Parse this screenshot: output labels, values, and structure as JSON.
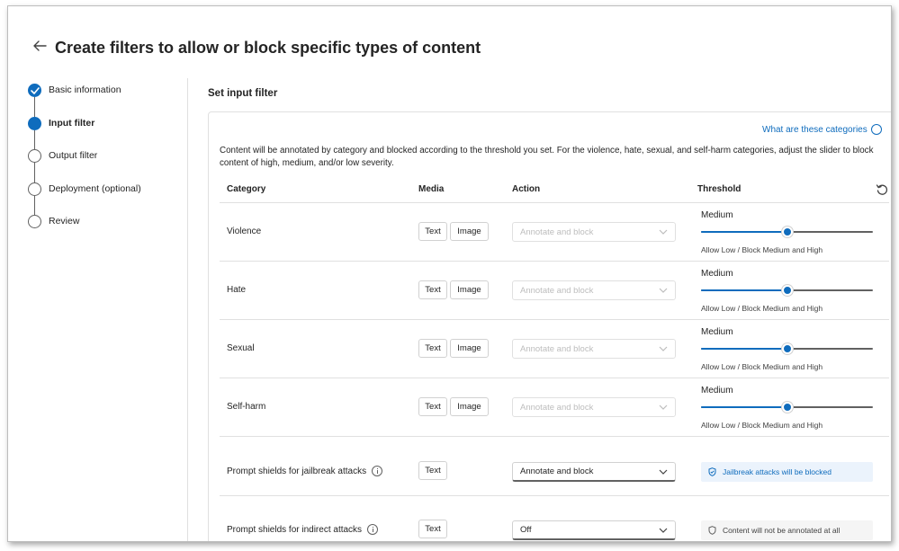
{
  "page": {
    "title": "Create filters to allow or block specific types of content"
  },
  "steps": [
    {
      "label": "Basic information",
      "state": "done"
    },
    {
      "label": "Input filter",
      "state": "current"
    },
    {
      "label": "Output filter",
      "state": "pending"
    },
    {
      "label": "Deployment (optional)",
      "state": "pending"
    },
    {
      "label": "Review",
      "state": "pending"
    }
  ],
  "section": {
    "title": "Set input filter",
    "link": "What are these categories",
    "description": "Content will be annotated by category and blocked according to the threshold you set. For the violence, hate, sexual, and self-harm categories, adjust the slider to block content of high, medium, and/or low severity."
  },
  "table": {
    "headers": {
      "category": "Category",
      "media": "Media",
      "action": "Action",
      "threshold": "Threshold"
    },
    "rows": [
      {
        "category": "Violence",
        "text": "Text",
        "image": "Image",
        "action": "Annotate and block",
        "level": "Medium",
        "threshold_desc": "Allow Low / Block Medium and High",
        "slider_value": 0.5
      },
      {
        "category": "Hate",
        "text": "Text",
        "image": "Image",
        "action": "Annotate and block",
        "level": "Medium",
        "threshold_desc": "Allow Low / Block Medium and High",
        "slider_value": 0.5
      },
      {
        "category": "Sexual",
        "text": "Text",
        "image": "Image",
        "action": "Annotate and block",
        "level": "Medium",
        "threshold_desc": "Allow Low / Block Medium and High",
        "slider_value": 0.5
      },
      {
        "category": "Self-harm",
        "text": "Text",
        "image": "Image",
        "action": "Annotate and block",
        "level": "Medium",
        "threshold_desc": "Allow Low / Block Medium and High",
        "slider_value": 0.5
      }
    ],
    "shields": [
      {
        "category": "Prompt shields for jailbreak attacks",
        "text": "Text",
        "action": "Annotate and block",
        "status": "Jailbreak attacks will be blocked"
      },
      {
        "category": "Prompt shields for indirect attacks",
        "text": "Text",
        "action": "Off",
        "status": "Content will not be annotated at all"
      }
    ]
  },
  "icons": {
    "back": "arrow-left-icon",
    "check": "checkmark-icon",
    "reset": "reset-icon",
    "info": "info-icon",
    "chevron": "chevron-down-icon",
    "shield": "shield-icon"
  },
  "colors": {
    "accent": "#0f6cbd",
    "status_blue_bg": "#ebf3fc",
    "status_gray_bg": "#f5f5f5",
    "border": "#e0e0e0"
  }
}
